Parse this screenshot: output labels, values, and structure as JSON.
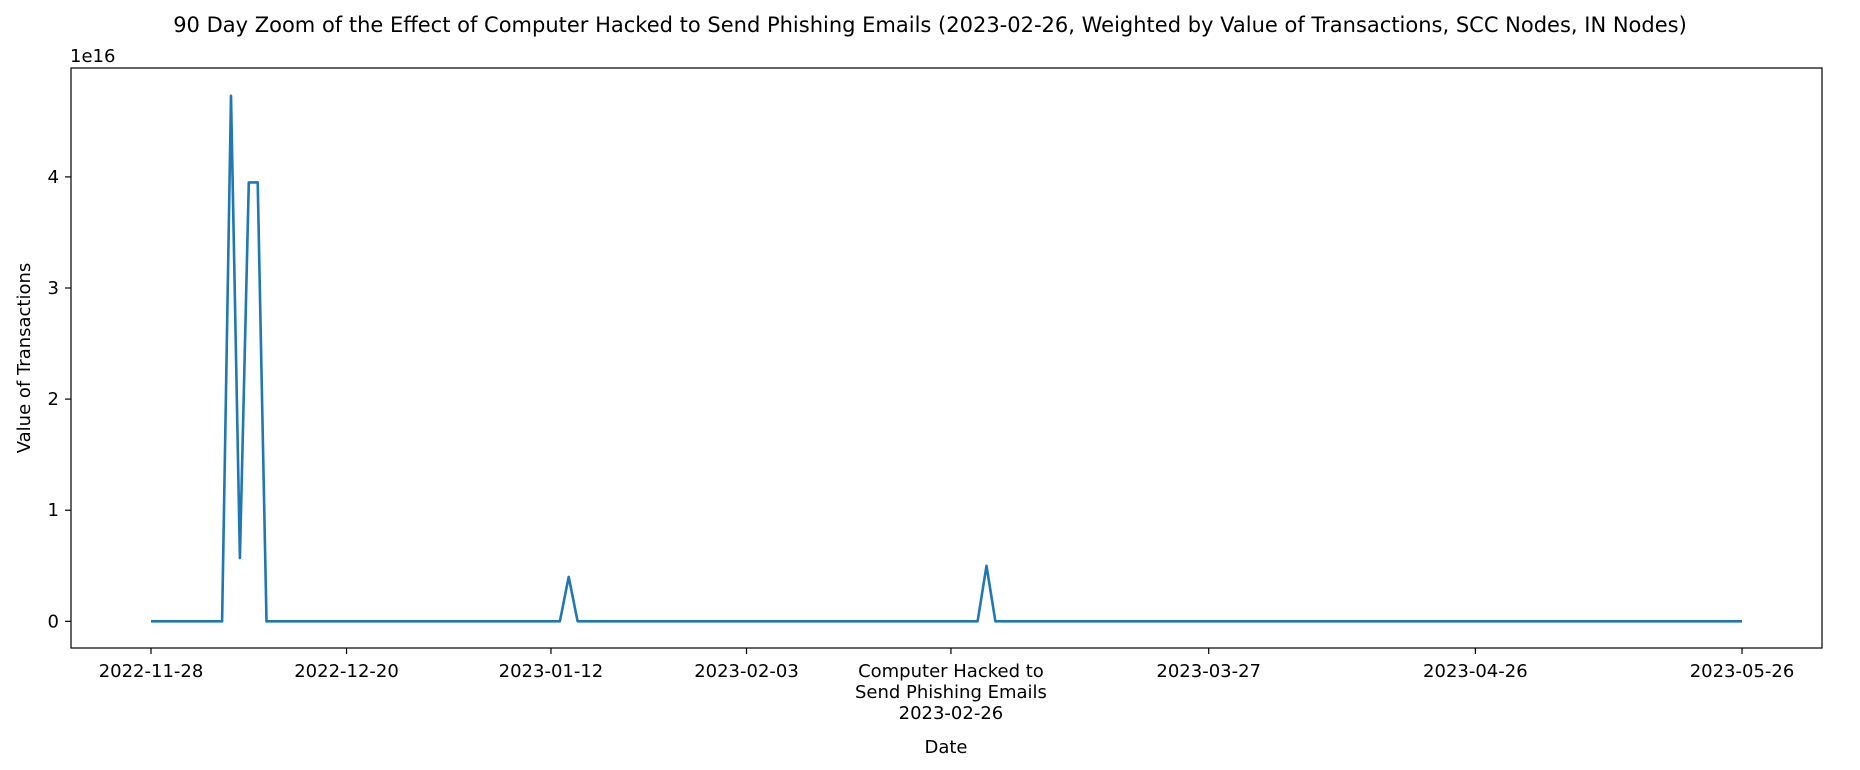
{
  "chart_data": {
    "type": "line",
    "title": "90 Day Zoom of the Effect of Computer Hacked to Send Phishing Emails (2023-02-26, Weighted by Value of Transactions, SCC Nodes, IN Nodes)",
    "xlabel": "Date",
    "ylabel": "Value of Transactions",
    "y_offset_label": "1e16",
    "y_scale": 1e+16,
    "xlim": [
      "2022-11-19",
      "2023-06-04"
    ],
    "ylim": [
      -0.24,
      4.98
    ],
    "x_ticks": [
      {
        "date": "2022-11-28",
        "label": "2022-11-28"
      },
      {
        "date": "2022-12-20",
        "label": "2022-12-20"
      },
      {
        "date": "2023-01-12",
        "label": "2023-01-12"
      },
      {
        "date": "2023-02-03",
        "label": "2023-02-03"
      },
      {
        "date": "2023-03-27",
        "label": "2023-03-27"
      },
      {
        "date": "2023-04-26",
        "label": "2023-04-26"
      },
      {
        "date": "2023-05-26",
        "label": "2023-05-26"
      }
    ],
    "y_ticks": [
      0,
      1,
      2,
      3,
      4
    ],
    "event_marker": {
      "date": "2023-02-26",
      "label_lines": [
        "Computer Hacked to",
        "Send Phishing Emails",
        "2023-02-26"
      ]
    },
    "grid": false,
    "color": "#1f77b4",
    "series": [
      {
        "x": [
          "2022-11-28",
          "2022-12-06",
          "2022-12-07",
          "2022-12-08",
          "2022-12-09",
          "2022-12-10",
          "2022-12-11",
          "2022-12-12",
          "2023-01-13",
          "2023-01-14",
          "2023-01-15",
          "2023-03-01",
          "2023-03-02",
          "2023-03-03",
          "2023-05-26"
        ],
        "y": [
          0,
          0,
          4.73,
          0.57,
          3.95,
          3.95,
          0,
          0,
          0,
          0.4,
          0,
          0,
          0.5,
          0,
          0
        ]
      }
    ]
  }
}
